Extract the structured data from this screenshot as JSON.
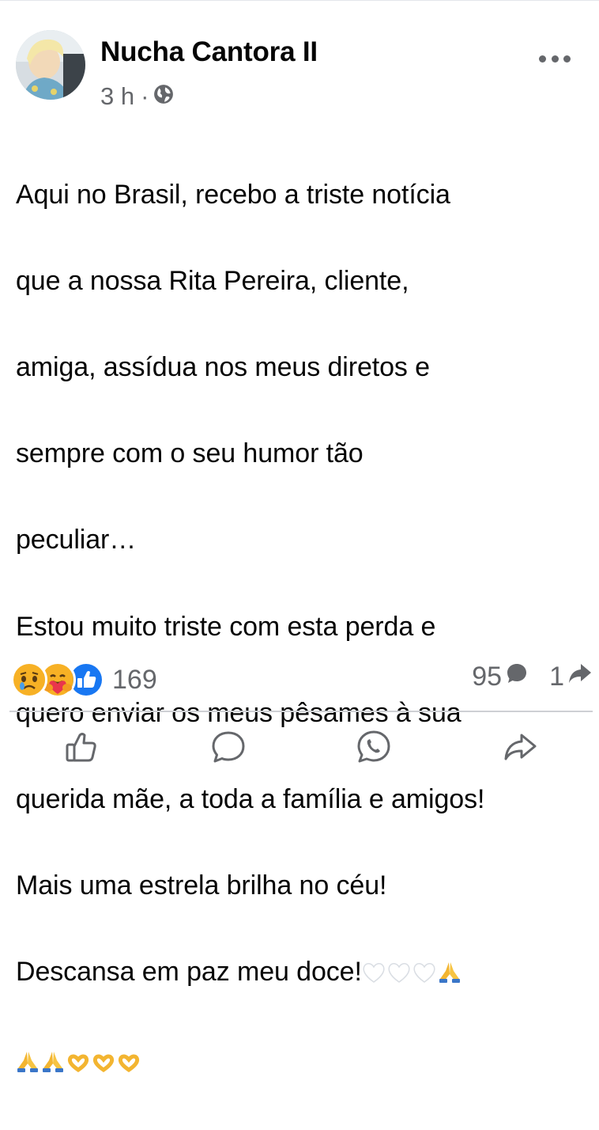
{
  "post": {
    "author": "Nucha Cantora II",
    "time": "3 h",
    "separator": "·",
    "privacy_icon": "globe-icon",
    "text_lines": [
      "Aqui no Brasil, recebo a triste notícia",
      "que a nossa Rita Pereira, cliente,",
      "amiga, assídua nos meus diretos e",
      "sempre com o seu humor tão",
      "peculiar…",
      "Estou muito triste com esta perda e",
      "quero enviar os meus pêsames à sua",
      "querida mãe, a toda a família e amigos!",
      "Mais uma estrela brilha no céu!",
      "Descansa em paz meu doce!"
    ],
    "emoji_line_10": [
      "white-heart-icon",
      "white-heart-icon",
      "white-heart-icon",
      "praying-hands-icon"
    ],
    "emoji_line_11": [
      "praying-hands-icon",
      "praying-hands-icon",
      "heart-hands-icon",
      "heart-hands-icon",
      "heart-hands-icon"
    ]
  },
  "reactions": {
    "icons": [
      "sad-face-icon",
      "care-face-icon",
      "like-icon"
    ],
    "count": "169"
  },
  "stats": {
    "comments": "95",
    "shares": "1"
  },
  "actions": [
    "like-button",
    "comment-button",
    "whatsapp-button",
    "share-button"
  ],
  "colors": {
    "text": "#050505",
    "secondary": "#65676b",
    "like_blue": "#1877f2",
    "sad_yellow": "#f7b125",
    "divider": "#ced0d4"
  }
}
